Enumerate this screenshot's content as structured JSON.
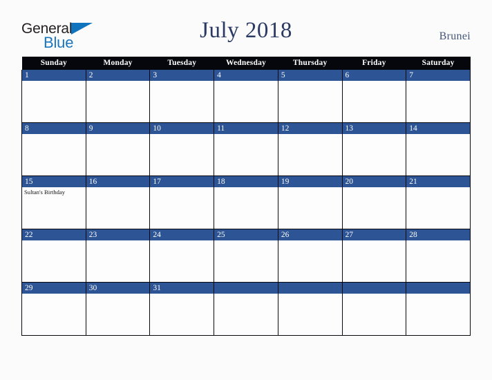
{
  "brand": {
    "name_part1": "General",
    "name_part2": "Blue",
    "triangle_icon": "triangle-icon",
    "color_dark": "#231f20",
    "color_blue": "#1b75bb"
  },
  "header": {
    "title": "July 2018",
    "country": "Brunei",
    "title_color": "#2b3a63"
  },
  "calendar": {
    "month": "July",
    "year": "2018",
    "accent_color": "#2d5494",
    "header_bg": "#05070d",
    "weekdays": [
      "Sunday",
      "Monday",
      "Tuesday",
      "Wednesday",
      "Thursday",
      "Friday",
      "Saturday"
    ],
    "weeks": [
      [
        {
          "day": "1",
          "events": []
        },
        {
          "day": "2",
          "events": []
        },
        {
          "day": "3",
          "events": []
        },
        {
          "day": "4",
          "events": []
        },
        {
          "day": "5",
          "events": []
        },
        {
          "day": "6",
          "events": []
        },
        {
          "day": "7",
          "events": []
        }
      ],
      [
        {
          "day": "8",
          "events": []
        },
        {
          "day": "9",
          "events": []
        },
        {
          "day": "10",
          "events": []
        },
        {
          "day": "11",
          "events": []
        },
        {
          "day": "12",
          "events": []
        },
        {
          "day": "13",
          "events": []
        },
        {
          "day": "14",
          "events": []
        }
      ],
      [
        {
          "day": "15",
          "events": [
            "Sultan's Birthday"
          ]
        },
        {
          "day": "16",
          "events": []
        },
        {
          "day": "17",
          "events": []
        },
        {
          "day": "18",
          "events": []
        },
        {
          "day": "19",
          "events": []
        },
        {
          "day": "20",
          "events": []
        },
        {
          "day": "21",
          "events": []
        }
      ],
      [
        {
          "day": "22",
          "events": []
        },
        {
          "day": "23",
          "events": []
        },
        {
          "day": "24",
          "events": []
        },
        {
          "day": "25",
          "events": []
        },
        {
          "day": "26",
          "events": []
        },
        {
          "day": "27",
          "events": []
        },
        {
          "day": "28",
          "events": []
        }
      ],
      [
        {
          "day": "29",
          "events": []
        },
        {
          "day": "30",
          "events": []
        },
        {
          "day": "31",
          "events": []
        },
        {
          "day": "",
          "events": []
        },
        {
          "day": "",
          "events": []
        },
        {
          "day": "",
          "events": []
        },
        {
          "day": "",
          "events": []
        }
      ]
    ]
  }
}
